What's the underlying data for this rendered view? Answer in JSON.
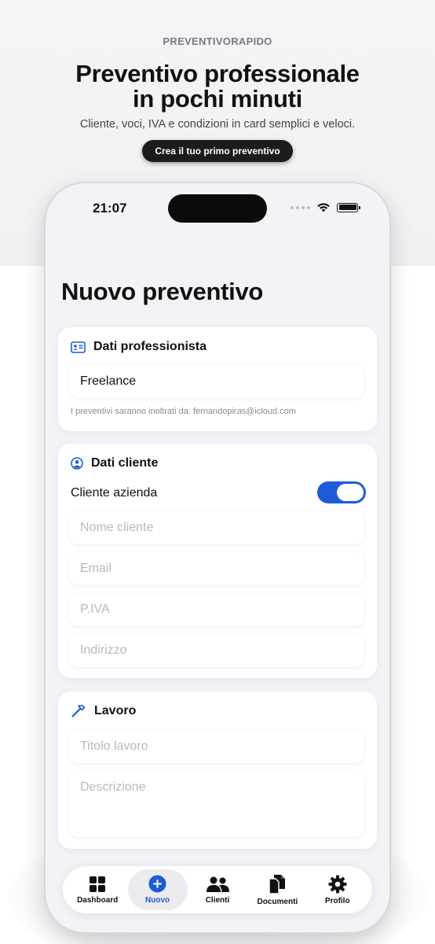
{
  "promo": {
    "brand": "PREVENTIVORAPIDO",
    "headline_line1": "Preventivo professionale",
    "headline_line2": "in pochi minuti",
    "subtitle": "Cliente, voci, IVA e condizioni in card semplici e veloci.",
    "cta_label": "Crea il tuo primo preventivo"
  },
  "status_bar": {
    "time": "21:07"
  },
  "screen": {
    "title": "Nuovo preventivo"
  },
  "professional_card": {
    "title": "Dati professionista",
    "icon": "id-card-icon",
    "name_value": "Freelance",
    "hint": "I preventivi saranno inoltrati da: fernandopiras@icloud.com"
  },
  "client_card": {
    "title": "Dati cliente",
    "icon": "person-circle-icon",
    "company_toggle_label": "Cliente azienda",
    "company_toggle_on": true,
    "name_placeholder": "Nome cliente",
    "email_placeholder": "Email",
    "vat_placeholder": "P.IVA",
    "address_placeholder": "Indirizzo"
  },
  "work_card": {
    "title": "Lavoro",
    "icon": "hammer-icon",
    "title_placeholder": "Titolo lavoro",
    "description_placeholder": "Descrizione"
  },
  "tabbar": {
    "items": [
      {
        "label": "Dashboard",
        "icon": "grid-icon"
      },
      {
        "label": "Nuovo",
        "icon": "plus-circle-icon",
        "active": true
      },
      {
        "label": "Clienti",
        "icon": "people-icon"
      },
      {
        "label": "Documenti",
        "icon": "documents-icon"
      },
      {
        "label": "Profilo",
        "icon": "gear-icon"
      }
    ]
  },
  "colors": {
    "accent": "#1e5bd6",
    "dark_button": "#1c1c1e",
    "screen_background": "#f2f2f7"
  }
}
